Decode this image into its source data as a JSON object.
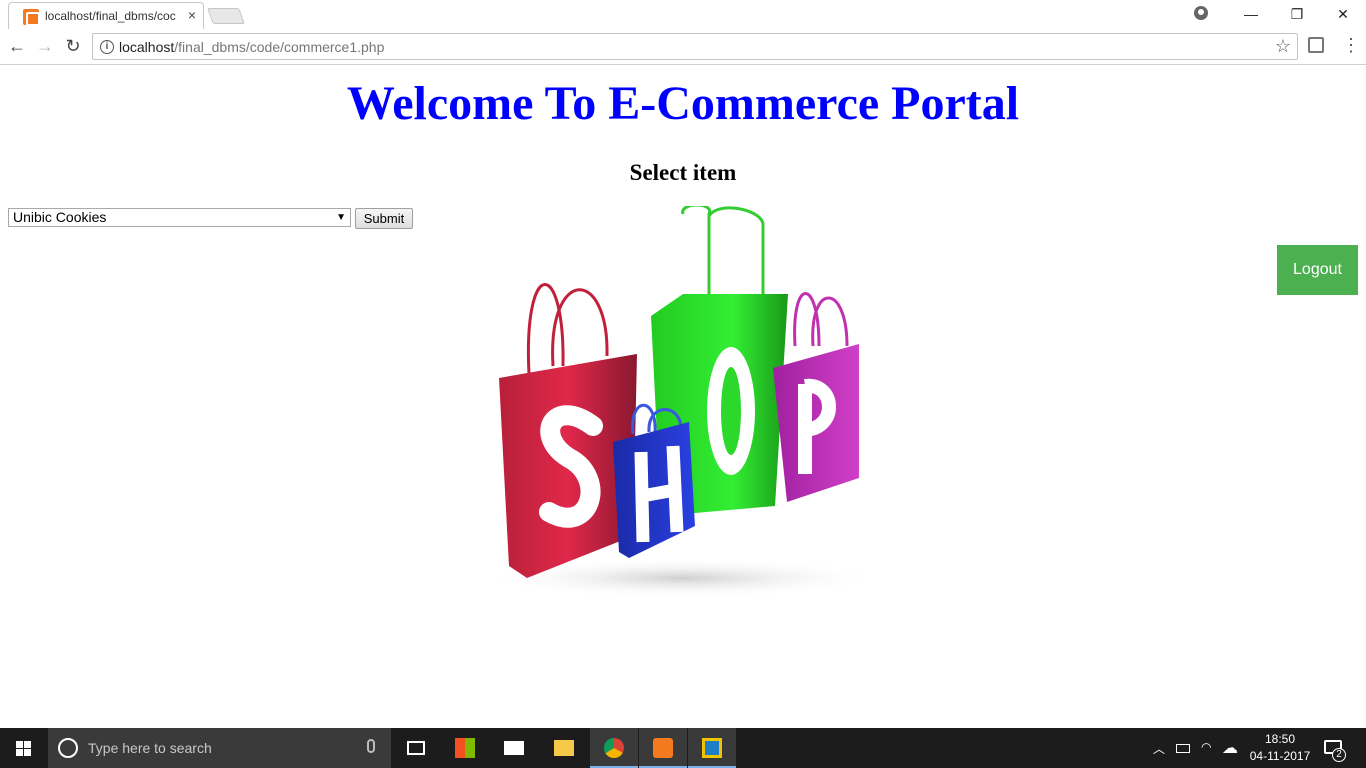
{
  "browser": {
    "tab_title": "localhost/final_dbms/coc",
    "tab_close": "×",
    "url_host": "localhost",
    "url_path": "/final_dbms/code/commerce1.php",
    "window_buttons": {
      "minimize": "—",
      "restore": "❐",
      "close": "✕"
    }
  },
  "page": {
    "heading": "Welcome To E-Commerce Portal",
    "subheading": "Select item",
    "select_value": "Unibic Cookies",
    "submit_label": "Submit",
    "logout_label": "Logout",
    "image_letters": [
      "S",
      "H",
      "O",
      "P"
    ],
    "colors": {
      "heading": "#0000ff",
      "logout_bg": "#4caf50"
    }
  },
  "taskbar": {
    "search_placeholder": "Type here to search",
    "clock_time": "18:50",
    "clock_date": "04-11-2017",
    "notification_count": "2",
    "pinned_icons": [
      "task-view-icon",
      "store-icon",
      "mail-icon",
      "file-explorer-icon",
      "chrome-icon",
      "xampp-icon",
      "virtualbox-icon"
    ]
  }
}
